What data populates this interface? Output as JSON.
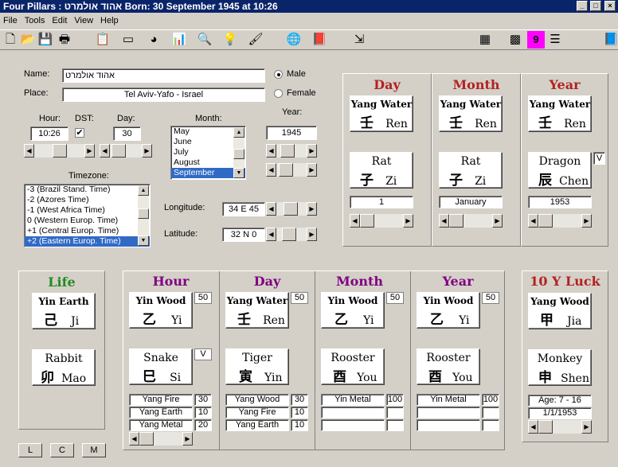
{
  "window": {
    "title": "Four Pillars : אהוד אולמרט  Born:  30 September 1945 at 10:26"
  },
  "menu": [
    "File",
    "Tools",
    "Edit",
    "View",
    "Help"
  ],
  "colors": {
    "red": "#b22222",
    "purple": "#800080",
    "green": "#228b22",
    "selection": "#316ac5"
  },
  "form": {
    "name_label": "Name:",
    "name_value": "אהוד אולמרט",
    "place_label": "Place:",
    "place_value": "Tel Aviv-Yafo - Israel",
    "male_label": "Male",
    "female_label": "Female",
    "hour_label": "Hour:",
    "hour_value": "10:26",
    "dst_label": "DST:",
    "dst_checked": "✔",
    "day_label": "Day:",
    "day_value": "30",
    "month_label": "Month:",
    "months": [
      "May",
      "June",
      "July",
      "August",
      "September"
    ],
    "year_label": "Year:",
    "year_value": "1945",
    "timezone_label": "Timezone:",
    "timezones": [
      "-3 (Brazil Stand.  Time)",
      "-2 (Azores Time)",
      "-1 (West Africa Time)",
      "0 (Western Europ. Time)",
      "+1 (Central Europ. Time)",
      "+2 (Eastern Europ. Time)"
    ],
    "longitude_label": "Longitude:",
    "longitude_value": "34 E 45",
    "latitude_label": "Latitude:",
    "latitude_value": "32 N 0"
  },
  "top_pillars": [
    {
      "title": "Day",
      "stem": "Yang Water",
      "stem_cn": "壬",
      "stem_py": "Ren",
      "branch": "Rat",
      "branch_cn": "子",
      "branch_py": "Zi",
      "info": "1"
    },
    {
      "title": "Month",
      "stem": "Yang Water",
      "stem_cn": "壬",
      "stem_py": "Ren",
      "branch": "Rat",
      "branch_cn": "子",
      "branch_py": "Zi",
      "info": "January"
    },
    {
      "title": "Year",
      "stem": "Yang Water",
      "stem_cn": "壬",
      "stem_py": "Ren",
      "branch": "Dragon",
      "branch_cn": "辰",
      "branch_py": "Chen",
      "info": "1953",
      "flag": "V"
    }
  ],
  "life": {
    "title": "Life",
    "stem": "Yin Earth",
    "stem_cn": "己",
    "stem_py": "Ji",
    "branch": "Rabbit",
    "branch_cn": "卯",
    "branch_py": "Mao"
  },
  "bottom_pillars": [
    {
      "title": "Hour",
      "stem": "Yin Wood",
      "stem_cn": "乙",
      "stem_py": "Yi",
      "score": "50",
      "branch": "Snake",
      "branch_cn": "巳",
      "branch_py": "Si",
      "flag": "V",
      "hidden": [
        [
          "Yang Fire",
          "30"
        ],
        [
          "Yang Earth",
          "10"
        ],
        [
          "Yang Metal",
          "20"
        ]
      ]
    },
    {
      "title": "Day",
      "stem": "Yang Water",
      "stem_cn": "壬",
      "stem_py": "Ren",
      "score": "50",
      "branch": "Tiger",
      "branch_cn": "寅",
      "branch_py": "Yin",
      "hidden": [
        [
          "Yang Wood",
          "30"
        ],
        [
          "Yang Fire",
          "10"
        ],
        [
          "Yang Earth",
          "10"
        ]
      ]
    },
    {
      "title": "Month",
      "stem": "Yin Wood",
      "stem_cn": "乙",
      "stem_py": "Yi",
      "score": "50",
      "branch": "Rooster",
      "branch_cn": "酉",
      "branch_py": "You",
      "hidden": [
        [
          "Yin Metal",
          "100"
        ],
        [
          "",
          ""
        ],
        [
          "",
          ""
        ]
      ]
    },
    {
      "title": "Year",
      "stem": "Yin Wood",
      "stem_cn": "乙",
      "stem_py": "Yi",
      "score": "50",
      "branch": "Rooster",
      "branch_cn": "酉",
      "branch_py": "You",
      "hidden": [
        [
          "Yin Metal",
          "100"
        ],
        [
          "",
          ""
        ],
        [
          "",
          ""
        ]
      ]
    }
  ],
  "luck": {
    "title": "10 Y Luck",
    "stem": "Yang Wood",
    "stem_cn": "甲",
    "stem_py": "Jia",
    "branch": "Monkey",
    "branch_cn": "申",
    "branch_py": "Shen",
    "age": "Age: 7 - 16",
    "date": "1/1/1953"
  },
  "buttons": {
    "l": "L",
    "c": "C",
    "m": "M"
  }
}
